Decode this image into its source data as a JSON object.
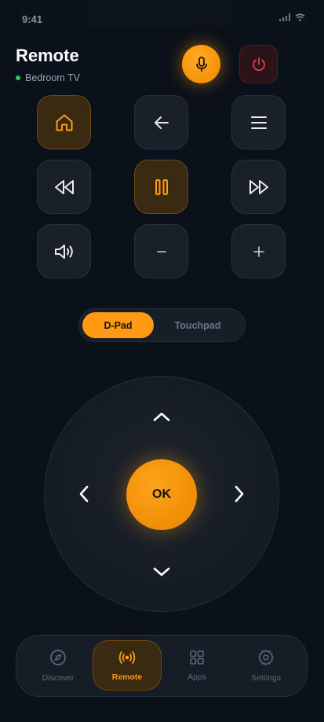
{
  "status": {
    "time": "9:41"
  },
  "header": {
    "title": "Remote",
    "device": "Bedroom TV"
  },
  "mode_toggle": {
    "dpad": "D-Pad",
    "touchpad": "Touchpad",
    "selected": "D-Pad"
  },
  "dpad": {
    "ok": "OK"
  },
  "nav": {
    "items": [
      {
        "label": "Discover",
        "icon": "compass-icon"
      },
      {
        "label": "Remote",
        "icon": "broadcast-icon",
        "active": true
      },
      {
        "label": "Apps",
        "icon": "grid-icon"
      },
      {
        "label": "Settings",
        "icon": "gear-icon"
      }
    ]
  },
  "colors": {
    "accent": "#FF9A12",
    "background": "#0B111A",
    "live": "#22D35B",
    "power": "#E0424E"
  },
  "keys": [
    "home-icon",
    "back-arrow-icon",
    "menu-icon",
    "rewind-icon",
    "pause-icon",
    "fast-forward-icon",
    "volume-icon",
    "minus-icon",
    "plus-icon"
  ]
}
